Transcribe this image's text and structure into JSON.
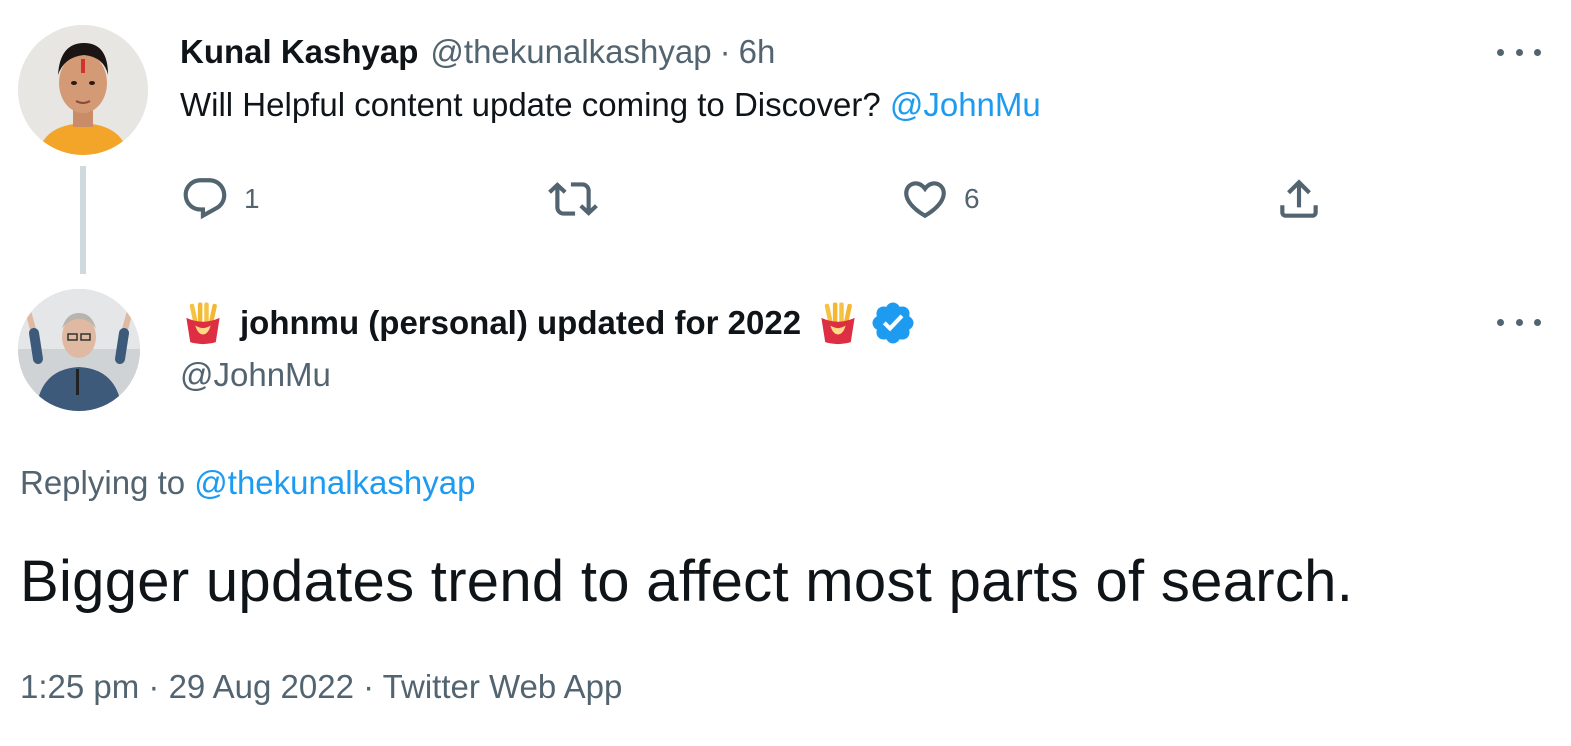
{
  "parent_tweet": {
    "author_name": "Kunal Kashyap",
    "handle": "@thekunalkashyap",
    "separator": "·",
    "time": "6h",
    "text": "Will Helpful content update coming to Discover?",
    "mention": "@JohnMu",
    "reply_count": "1",
    "retweet_count": "",
    "like_count": "6",
    "icons": [
      "reply-icon",
      "retweet-icon",
      "like-icon",
      "share-icon",
      "more-icon"
    ]
  },
  "reply_tweet": {
    "author_name": "johnmu (personal) updated for 2022",
    "handle": "@JohnMu",
    "replying_label": "Replying to",
    "replying_handle": "@thekunalkashyap",
    "text": "Bigger updates trend to affect most parts of search.",
    "timestamp": "1:25 pm · 29 Aug 2022 · Twitter Web App",
    "icons": [
      "fries-emoji-icon",
      "verified-badge-icon",
      "more-icon"
    ]
  },
  "colors": {
    "text": "#0f1419",
    "secondary": "#536471",
    "link": "#1d9bf0",
    "thread_line": "#cfd9de"
  }
}
